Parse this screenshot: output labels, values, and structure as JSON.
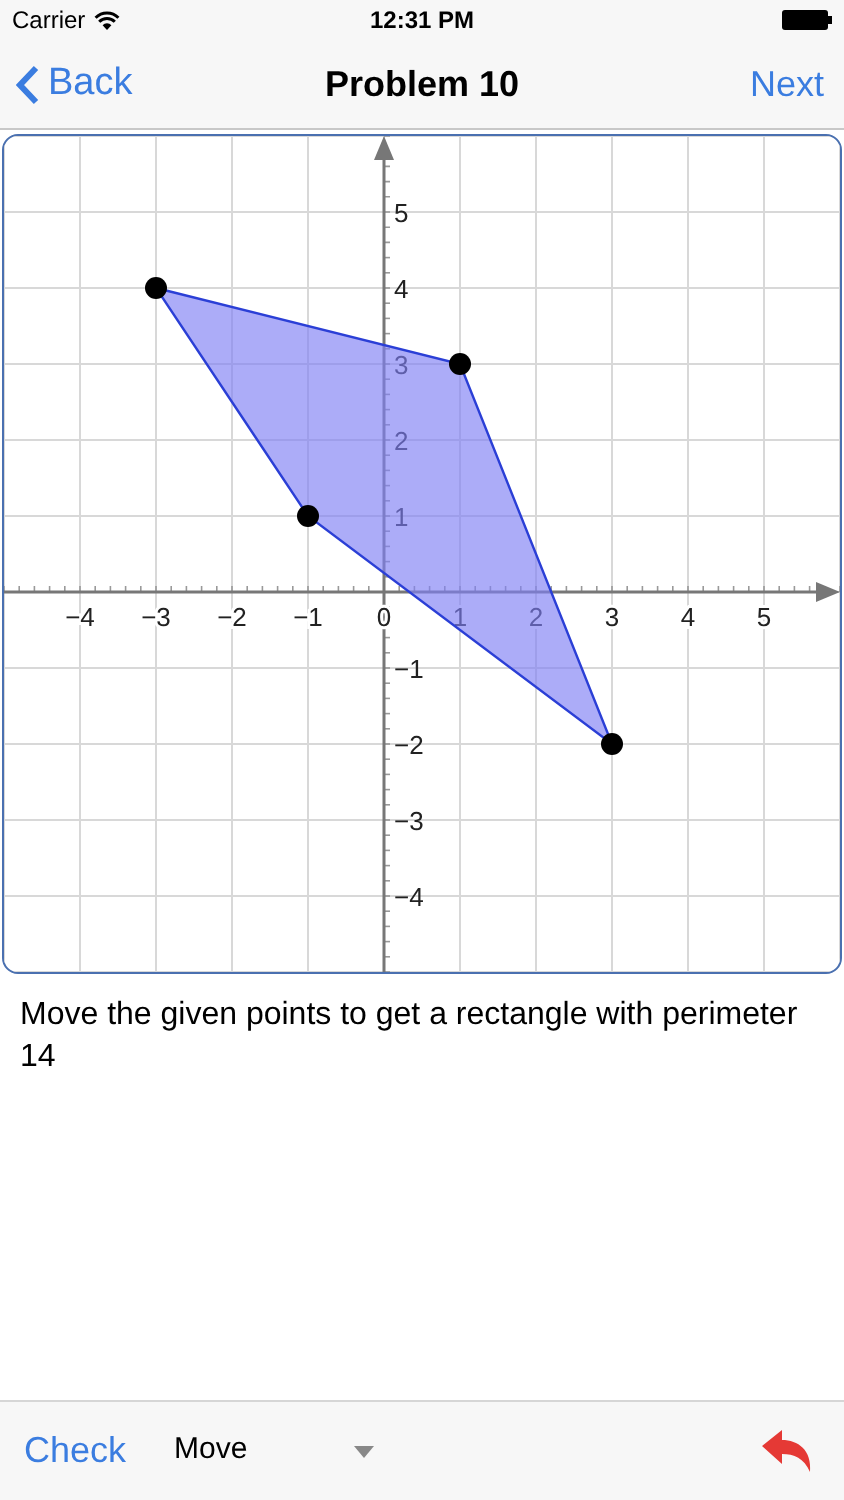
{
  "status_bar": {
    "carrier": "Carrier",
    "time": "12:31 PM"
  },
  "nav": {
    "back": "Back",
    "title": "Problem 10",
    "next": "Next"
  },
  "graph": {
    "chart_data": {
      "type": "scatter",
      "x": [
        -3,
        1,
        3,
        -1
      ],
      "values": [
        4,
        3,
        -2,
        1
      ],
      "xlim": [
        -5,
        6
      ],
      "ylim": [
        -5,
        6
      ],
      "grid": true,
      "xticks": [
        {
          "value": -4,
          "label": "−4"
        },
        {
          "value": -3,
          "label": "−3"
        },
        {
          "value": -2,
          "label": "−2"
        },
        {
          "value": -1,
          "label": "−1"
        },
        {
          "value": 0,
          "label": "0"
        },
        {
          "value": 1,
          "label": "1"
        },
        {
          "value": 2,
          "label": "2"
        },
        {
          "value": 3,
          "label": "3"
        },
        {
          "value": 4,
          "label": "4"
        },
        {
          "value": 5,
          "label": "5"
        }
      ],
      "yticks": [
        {
          "value": -4,
          "label": "−4"
        },
        {
          "value": -3,
          "label": "−3"
        },
        {
          "value": -2,
          "label": "−2"
        },
        {
          "value": -1,
          "label": "−1"
        },
        {
          "value": 1,
          "label": "1"
        },
        {
          "value": 2,
          "label": "2"
        },
        {
          "value": 3,
          "label": "3"
        },
        {
          "value": 4,
          "label": "4"
        },
        {
          "value": 5,
          "label": "5"
        }
      ]
    }
  },
  "instruction": "Move the given points to get a rectangle with perimeter 14",
  "toolbar": {
    "check": "Check",
    "mode": "Move"
  }
}
